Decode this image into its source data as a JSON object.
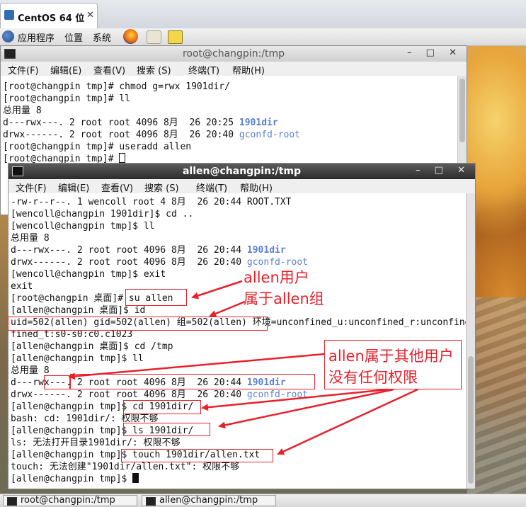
{
  "browser_tab": {
    "title": "CentOS 64 位",
    "close": "✕"
  },
  "panel": {
    "applications": "应用程序",
    "places": "位置",
    "system": "系统"
  },
  "terminal1": {
    "title": "root@changpin:/tmp",
    "controls": "– □ ✕",
    "menu": [
      "文件(F)",
      "编辑(E)",
      "查看(V)",
      "搜索 (S)",
      "终端(T)",
      "帮助(H)"
    ],
    "lines": [
      "[root@changpin tmp]# chmod g=rwx 1901dir/",
      "[root@changpin tmp]# ll",
      "总用量 8",
      "d---rwx---. 2 root root 4096 8月  26 20:25 ",
      "drwx------. 2 root root 4096 8月  26 20:40 ",
      "[root@changpin tmp]# useradd allen",
      "[root@changpin tmp]# "
    ],
    "dir1": "1901dir",
    "dir2": "gconfd-root"
  },
  "terminal2": {
    "title": "allen@changpin:/tmp",
    "controls": "– □ ✕",
    "menu": [
      "文件(F)",
      "编辑(E)",
      "查看(V)",
      "搜索 (S)",
      "终端(T)",
      "帮助(H)"
    ],
    "lines": [
      "-rw-r--r--. 1 wencoll root 4 8月  26 20:44 ROOT.TXT",
      "[wencoll@changpin 1901dir]$ cd ..",
      "[wencoll@changpin tmp]$ ll",
      "总用量 8",
      "d---rwx---. 2 root root 4096 8月  26 20:44 ",
      "drwx------. 2 root root 4096 8月  26 20:40 ",
      "[wencoll@changpin tmp]$ exit",
      "exit",
      "[root@changpin 桌面]# su allen",
      "[allen@changpin 桌面]$ id",
      "uid=502(allen) gid=502(allen) 组=502(allen) 环境=unconfined_u:unconfined_r:unconfined_t:s0-s0:c0.c1023",
      "fined_t:s0-s0:c0.c1023",
      "[allen@changpin 桌面]$ cd /tmp",
      "[allen@changpin tmp]$ ll",
      "总用量 8",
      "d---rwx---. 2 root root 4096 8月  26 20:44 ",
      "drwx------. 2 root root 4096 8月  26 20:40 ",
      "[allen@changpin tmp]$ cd 1901dir/",
      "bash: cd: 1901dir/: 权限不够",
      "[allen@changpin tmp]$ ls 1901dir/",
      "ls: 无法打开目录1901dir/: 权限不够",
      "[allen@changpin tmp]$ touch 1901dir/allen.txt",
      "touch: 无法创建\"1901dir/allen.txt\": 权限不够",
      "[allen@changpin tmp]$ "
    ],
    "dir1": "1901dir",
    "dir2": "gconfd-root"
  },
  "annotations": {
    "note1_line1": "allen用户",
    "note1_line2": "属于allen组",
    "note2_line1": "allen属于其他用户",
    "note2_line2": "没有任何权限"
  },
  "taskbar": [
    {
      "label": "root@changpin:/tmp"
    },
    {
      "label": "allen@changpin:/tmp"
    }
  ],
  "colors": {
    "annotation": "#e8202a",
    "directory": "#5b7fd0"
  }
}
